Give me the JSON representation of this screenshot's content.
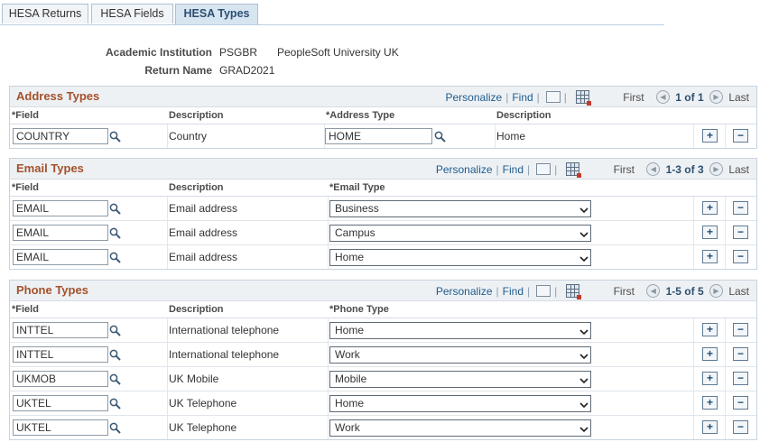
{
  "tabs": [
    {
      "label": "HESA Returns"
    },
    {
      "label": "HESA Fields"
    },
    {
      "label": "HESA Types"
    }
  ],
  "header": {
    "institution_label": "Academic Institution",
    "institution_code": "PSGBR",
    "institution_name": "PeopleSoft University UK",
    "return_label": "Return Name",
    "return_value": "GRAD2021"
  },
  "nav": {
    "personalize": "Personalize",
    "find": "Find",
    "first": "First",
    "last": "Last"
  },
  "address": {
    "title": "Address Types",
    "count": "1 of 1",
    "col_field": "*Field",
    "col_desc": "Description",
    "col_type": "*Address Type",
    "col_type_desc": "Description",
    "rows": [
      {
        "field": "COUNTRY",
        "desc": "Country",
        "type": "HOME",
        "type_desc": "Home"
      }
    ]
  },
  "email": {
    "title": "Email Types",
    "count": "1-3 of 3",
    "col_field": "*Field",
    "col_desc": "Description",
    "col_type": "*Email Type",
    "rows": [
      {
        "field": "EMAIL",
        "desc": "Email address",
        "type": "Business"
      },
      {
        "field": "EMAIL",
        "desc": "Email address",
        "type": "Campus"
      },
      {
        "field": "EMAIL",
        "desc": "Email address",
        "type": "Home"
      }
    ]
  },
  "phone": {
    "title": "Phone Types",
    "count": "1-5 of 5",
    "col_field": "*Field",
    "col_desc": "Description",
    "col_type": "*Phone Type",
    "rows": [
      {
        "field": "INTTEL",
        "desc": "International telephone",
        "type": "Home"
      },
      {
        "field": "INTTEL",
        "desc": "International telephone",
        "type": "Work"
      },
      {
        "field": "UKMOB",
        "desc": "UK Mobile",
        "type": "Mobile"
      },
      {
        "field": "UKTEL",
        "desc": "UK Telephone",
        "type": "Home"
      },
      {
        "field": "UKTEL",
        "desc": "UK Telephone",
        "type": "Work"
      }
    ]
  },
  "buttons": {
    "add": "+",
    "delete": "−"
  }
}
